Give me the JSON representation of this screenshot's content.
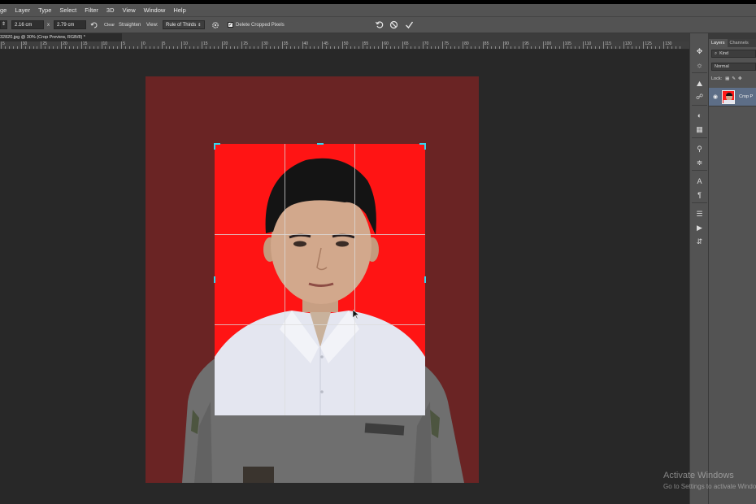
{
  "menubar": {
    "items": [
      "ge",
      "Layer",
      "Type",
      "Select",
      "Filter",
      "3D",
      "View",
      "Window",
      "Help"
    ]
  },
  "options": {
    "width_value": "2.16 cm",
    "swap_symbol": "x",
    "height_value": "2.79 cm",
    "clear_label": "Clear",
    "straighten_label": "Straighten",
    "view_label": "View:",
    "view_value": "Rule of Thirds",
    "delete_cropped_label": "Delete Cropped Pixels",
    "delete_cropped_checked": true
  },
  "document": {
    "tab_title": "32820.jpg @ 30% (Crop Preview, RGB/8) *",
    "ruler_labels": [
      "5",
      "30",
      "25",
      "20",
      "15",
      "10",
      "5",
      "0",
      "5",
      "10",
      "15",
      "20",
      "25",
      "30",
      "35",
      "40",
      "45",
      "50",
      "55",
      "60",
      "65",
      "70",
      "75",
      "80",
      "85",
      "90",
      "95",
      "100",
      "105",
      "110",
      "115",
      "120",
      "125",
      "130"
    ],
    "canvas_color": "#6a2424",
    "crop_background": "#ff1414",
    "handle_color": "#33d6f0"
  },
  "tools": [
    "move-icon",
    "history-icon",
    "paint-bucket-icon",
    "adjustments-icon",
    "color-icon",
    "swatches-icon",
    "clone-icon",
    "sliders-icon",
    "character-icon",
    "paragraph-icon",
    "channels-icon",
    "play-icon",
    "timeline-icon"
  ],
  "layers_panel": {
    "tabs": [
      "Layers",
      "Channels"
    ],
    "active_tab": "Layers",
    "filter_label": "Kind",
    "blend_mode": "Normal",
    "lock_label": "Lock:",
    "layer_name": "Crop P"
  },
  "watermark": {
    "title": "Activate Windows",
    "subtitle": "Go to Settings to activate Windows."
  }
}
